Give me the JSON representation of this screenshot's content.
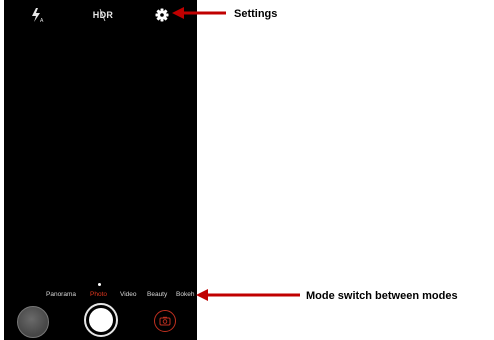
{
  "top_bar": {
    "flash_icon": "flash-auto-icon",
    "hdr_label": "HDR",
    "settings_icon": "gear-icon"
  },
  "modes": {
    "items": [
      "Panorama",
      "Photo",
      "Video",
      "Beauty",
      "Bokeh"
    ],
    "selected": "Photo"
  },
  "controls": {
    "gallery_icon": "gallery-thumbnail",
    "shutter_icon": "shutter-button",
    "switch_icon": "switch-camera-icon"
  },
  "annotations": {
    "settings": "Settings",
    "modes": "Mode switch between modes"
  },
  "colors": {
    "background": "#000000",
    "accent": "#e0371f",
    "arrow": "#c00000"
  }
}
